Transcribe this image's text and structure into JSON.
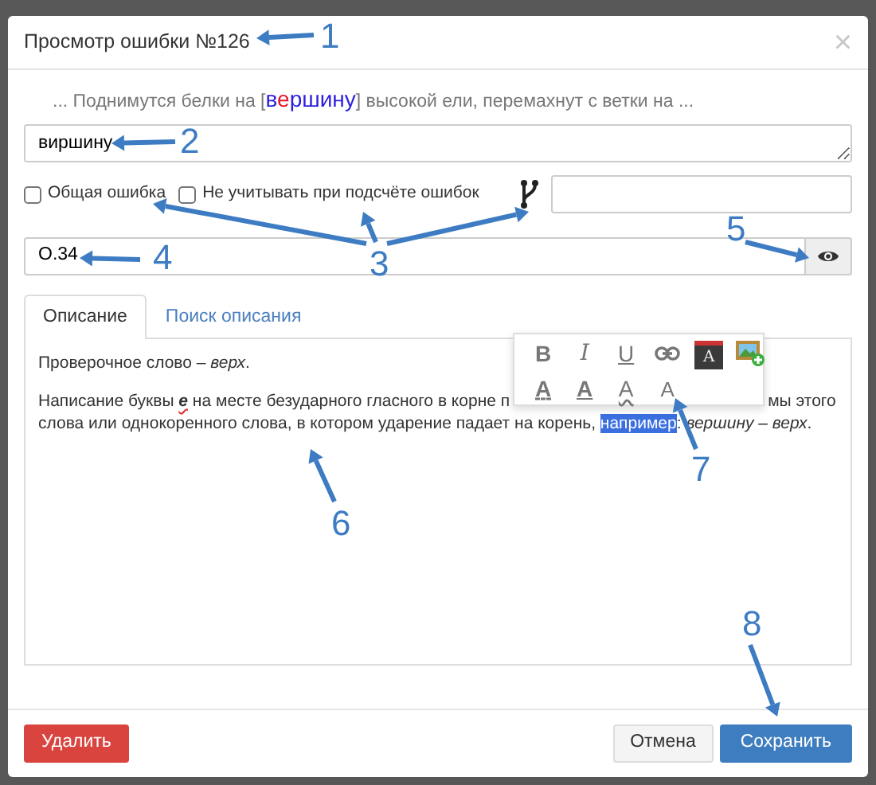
{
  "dialog": {
    "title": "Просмотр ошибки №126",
    "close": "×"
  },
  "context": {
    "before": "... Поднимутся белки на [",
    "word": [
      {
        "text": "в",
        "color": "#2b1ee0"
      },
      {
        "text": "е",
        "color": "#e3162b"
      },
      {
        "text": "ршину",
        "color": "#2b1ee0"
      }
    ],
    "after": "] высокой ели, перемахнут с ветки на ..."
  },
  "correction": {
    "value": "виршину"
  },
  "checkboxes": [
    {
      "label": "Общая ошибка",
      "checked": false
    },
    {
      "label": "Не учитывать при подсчёте ошибок",
      "checked": false
    }
  ],
  "rule_field": {
    "value": "О.34"
  },
  "tabs": [
    {
      "label": "Описание",
      "selected": true
    },
    {
      "label": "Поиск описания",
      "selected": false
    }
  ],
  "description": {
    "check_word": "Проверочное слово – *верх*.",
    "segments": [
      {
        "kind": "plain",
        "text": "Написание буквы **е** на месте безударного гласного в корне п"
      },
      {
        "kind": "gap"
      },
      {
        "kind": "plain",
        "text": "мы этого слова или однокоренного слова, в котором ударение падает на корень, "
      },
      {
        "kind": "selected",
        "text": "например"
      },
      {
        "kind": "plain",
        "text": ": *вершину – верх*."
      }
    ]
  },
  "toolbar": [
    {
      "kind": "bold",
      "label": "B"
    },
    {
      "kind": "italic",
      "label": "I"
    },
    {
      "kind": "underline",
      "label": "U"
    },
    {
      "kind": "link"
    },
    {
      "kind": "style",
      "label": "A"
    },
    {
      "kind": "image"
    },
    {
      "kind": "a-dashed",
      "label": "A"
    },
    {
      "kind": "a-underline",
      "label": "A"
    },
    {
      "kind": "a-wavy",
      "label": "A"
    },
    {
      "kind": "a-thin",
      "label": "A"
    }
  ],
  "buttons": [
    {
      "kind": "danger",
      "label": "Удалить"
    },
    {
      "kind": "default",
      "label": "Отмена"
    },
    {
      "kind": "primary",
      "label": "Сохранить"
    }
  ],
  "annotations": [
    {
      "label": "1"
    },
    {
      "label": "2"
    },
    {
      "label": "3"
    },
    {
      "label": "4"
    },
    {
      "label": "5"
    },
    {
      "label": "6"
    },
    {
      "label": "7"
    },
    {
      "label": "8"
    }
  ]
}
